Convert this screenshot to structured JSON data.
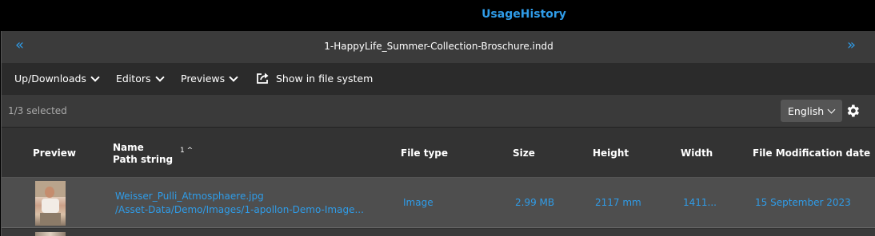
{
  "app": {
    "title": "UsageHistory"
  },
  "document": {
    "title": "1-HappyLife_Summer-Collection-Broschure.indd",
    "prev": "«",
    "next": "»"
  },
  "toolbar": {
    "up_downloads": "Up/Downloads",
    "editors": "Editors",
    "previews": "Previews",
    "show_in_fs": "Show in file system"
  },
  "status": {
    "selection": "1/3 selected",
    "language": "English"
  },
  "table": {
    "headers": {
      "preview": "Preview",
      "name": "Name",
      "path": "Path string",
      "sort": "1 ^",
      "file_type": "File type",
      "size": "Size",
      "height": "Height",
      "width": "Width",
      "modified": "File Modification date"
    },
    "rows": [
      {
        "name": "Weisser_Pulli_Atmosphaere.jpg",
        "path": "/Asset-Data/Demo/Images/1-apollon-Demo-Image...",
        "file_type": "Image",
        "size": "2.99 MB",
        "height": "2117 mm",
        "width": "1411...",
        "modified": "15 September 2023"
      }
    ]
  },
  "colors": {
    "accent": "#2f9ce8",
    "background": "#323232",
    "selected_row": "#4e4e4e"
  }
}
